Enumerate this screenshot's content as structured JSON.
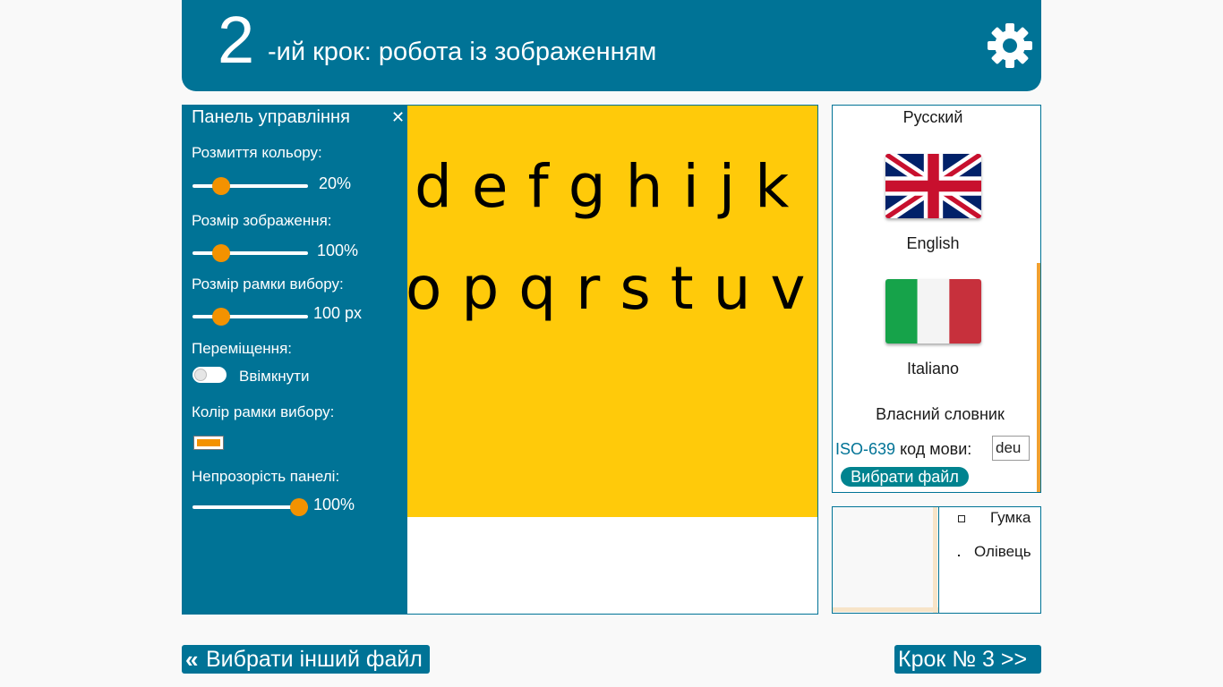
{
  "header": {
    "step_number": "2",
    "step_title": "-ий крок: робота із зображенням",
    "settings_icon": "gear-icon"
  },
  "image": {
    "background_color": "#ffca0a",
    "row1": "defghijk",
    "row2_edge": "o",
    "row2": "pqrstuv"
  },
  "control_panel": {
    "title": "Панель управління",
    "close_icon": "close-icon",
    "color_blur": {
      "label": "Розмиття кольору:",
      "value": "20%",
      "level": 0.2
    },
    "image_size": {
      "label": "Розмір зображення:",
      "value": "100%",
      "level": 0.2
    },
    "selection_size": {
      "label": "Розмір рамки вибору:",
      "value": "100 px",
      "level": 0.2
    },
    "move": {
      "label": "Переміщення:",
      "toggle_label": "Ввімкнути",
      "enabled": false
    },
    "selection_color": {
      "label": "Колір рамки вибору:",
      "color": "#f39200"
    },
    "panel_opacity": {
      "label": "Непрозорість панелі:",
      "value": "100%",
      "level": 1.0
    }
  },
  "languages": {
    "items": [
      {
        "name": "Русский"
      },
      {
        "name": "English",
        "flag": "uk-flag-icon"
      },
      {
        "name": "Italiano",
        "flag": "italy-flag-icon"
      }
    ],
    "custom_dictionary": "Власний словник",
    "iso_link": "ISO-639",
    "iso_label": "код мови:",
    "iso_value": "deu",
    "choose_file": "Вибрати файл"
  },
  "tools": {
    "eraser": "Гумка",
    "pencil": "Олівець"
  },
  "footer": {
    "back_label": "Вибрати інший файл",
    "next_label": "Крок № 3 >>"
  },
  "colors": {
    "primary": "#007396",
    "accent": "#f39200",
    "image_bg": "#ffca0a"
  }
}
